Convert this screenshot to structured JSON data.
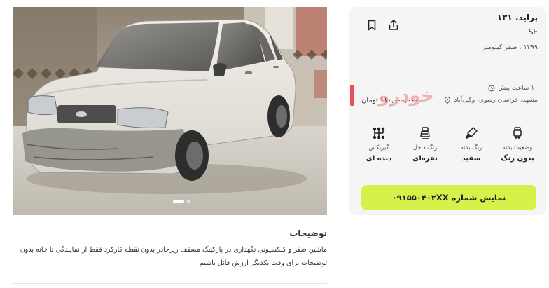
{
  "listing": {
    "title": "پراید، ۱۳۱",
    "trim": "SE",
    "year_mileage": "۱۳۹۹ ، صفر کیلومتر",
    "price": "۱۱۰,۰۰۰,۰۰۰ تومان",
    "watermark_text": "خودرو",
    "posted_time": "۱۰ ساعت پیش",
    "location": "مشهد، خراسان رضوی، وکیل‌آباد"
  },
  "actions": {
    "share_icon": "share-icon",
    "bookmark_icon": "bookmark-icon"
  },
  "specs": [
    {
      "label": "وضعیت بدنه",
      "value": "بدون رنگ",
      "icon": "body-condition-icon"
    },
    {
      "label": "رنگ بدنه",
      "value": "سفید",
      "icon": "paint-brush-icon"
    },
    {
      "label": "رنگ داخل",
      "value": "نقره‌ای",
      "icon": "seat-icon"
    },
    {
      "label": "گیربکس",
      "value": "دنده ای",
      "icon": "gearbox-icon"
    }
  ],
  "call_button": {
    "label": "نمایش شماره ۰۹۱۵۵۰۴۰۲XX"
  },
  "description": {
    "title": "توضیحات",
    "lines": [
      "ماشین صفر و کلکسیونی نگهداری در پارکینگ مسقف زیرچادر بدون نقطه کارکرد فقط از نمایندگی تا خانه بدون",
      "توضیحات برای وقت یکدیگر ارزش قائل باشیم"
    ]
  },
  "gallery": {
    "slides": 2,
    "active_slide": 1
  },
  "colors": {
    "accent": "#d8f04a",
    "brand_red": "#e8343c",
    "card_bg": "#f5f5f5"
  }
}
